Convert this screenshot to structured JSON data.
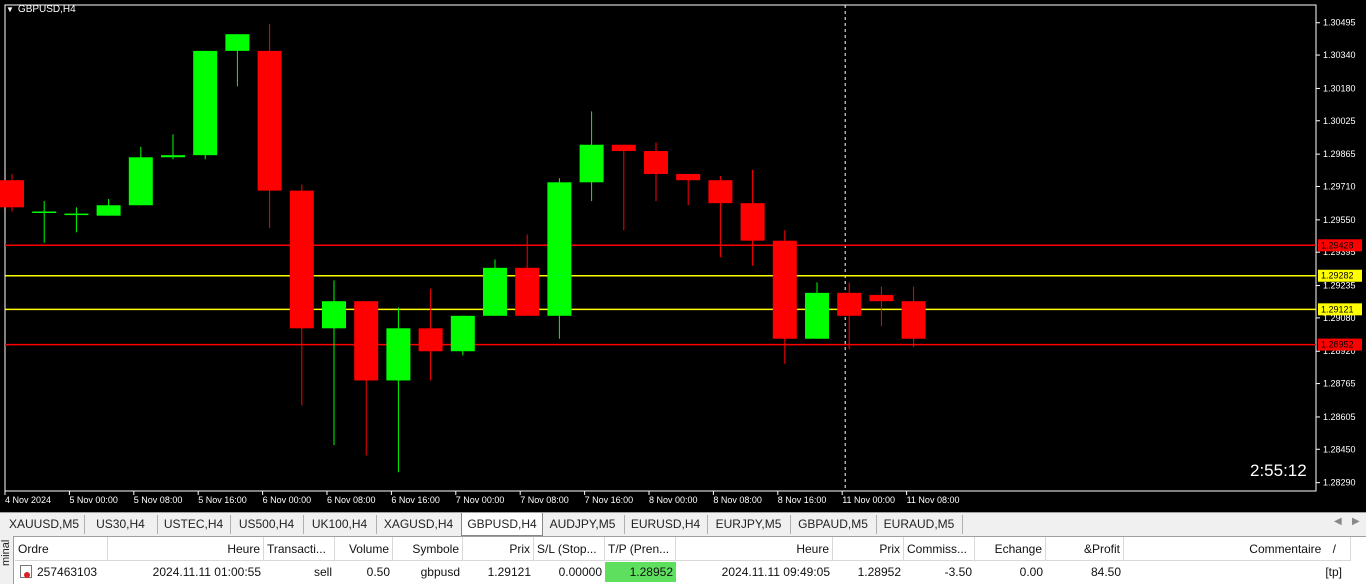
{
  "chart": {
    "symbol_title": "GBPUSD,H4",
    "timer": "2:55:12",
    "price_axis": [
      "1.30495",
      "1.30340",
      "1.30180",
      "1.30025",
      "1.29865",
      "1.29710",
      "1.29550",
      "1.29395",
      "1.29235",
      "1.29080",
      "1.28920",
      "1.28765",
      "1.28605",
      "1.28450",
      "1.28290"
    ],
    "time_axis": [
      "4 Nov 2024",
      "5 Nov 00:00",
      "5 Nov 08:00",
      "5 Nov 16:00",
      "6 Nov 00:00",
      "6 Nov 08:00",
      "6 Nov 16:00",
      "7 Nov 00:00",
      "7 Nov 08:00",
      "7 Nov 16:00",
      "8 Nov 00:00",
      "8 Nov 08:00",
      "8 Nov 16:00",
      "11 Nov 00:00",
      "11 Nov 08:00"
    ],
    "level_labels": {
      "red_top": "1.29428",
      "yellow_top": "1.29282",
      "yellow_bottom": "1.29121",
      "red_bottom": "1.28952"
    },
    "colors": {
      "bull": "#00ff00",
      "bear": "#ff0000",
      "background": "#000000",
      "red_line": "#ff0000",
      "yellow_line": "#ffff00",
      "text": "#ffffff"
    }
  },
  "chart_data": {
    "type": "candlestick",
    "title": "GBPUSD,H4",
    "ylim": [
      1.2825,
      1.3058
    ],
    "levels": [
      1.29428,
      1.29282,
      1.29121,
      1.28952
    ],
    "candles": [
      {
        "o": 1.2974,
        "h": 1.2977,
        "l": 1.2959,
        "c": 1.2961
      },
      {
        "o": 1.2959,
        "h": 1.2964,
        "l": 1.2944,
        "c": 1.2959
      },
      {
        "o": 1.2958,
        "h": 1.2961,
        "l": 1.2949,
        "c": 1.2958
      },
      {
        "o": 1.2957,
        "h": 1.2965,
        "l": 1.2957,
        "c": 1.2962
      },
      {
        "o": 1.2962,
        "h": 1.299,
        "l": 1.2962,
        "c": 1.2985
      },
      {
        "o": 1.2985,
        "h": 1.2996,
        "l": 1.2984,
        "c": 1.2986
      },
      {
        "o": 1.2986,
        "h": 1.3036,
        "l": 1.2984,
        "c": 1.3036
      },
      {
        "o": 1.3036,
        "h": 1.304,
        "l": 1.3019,
        "c": 1.3044
      },
      {
        "o": 1.3036,
        "h": 1.3049,
        "l": 1.2951,
        "c": 1.2969
      },
      {
        "o": 1.2969,
        "h": 1.2972,
        "l": 1.2866,
        "c": 1.2903
      },
      {
        "o": 1.2903,
        "h": 1.2926,
        "l": 1.2847,
        "c": 1.2916
      },
      {
        "o": 1.2916,
        "h": 1.2912,
        "l": 1.2842,
        "c": 1.2878
      },
      {
        "o": 1.2878,
        "h": 1.2913,
        "l": 1.2834,
        "c": 1.2903
      },
      {
        "o": 1.2903,
        "h": 1.2922,
        "l": 1.2878,
        "c": 1.2892
      },
      {
        "o": 1.2892,
        "h": 1.2904,
        "l": 1.289,
        "c": 1.2909
      },
      {
        "o": 1.2909,
        "h": 1.2936,
        "l": 1.2911,
        "c": 1.2932
      },
      {
        "o": 1.2932,
        "h": 1.2948,
        "l": 1.2917,
        "c": 1.2909
      },
      {
        "o": 1.2909,
        "h": 1.2975,
        "l": 1.2898,
        "c": 1.2973
      },
      {
        "o": 1.2973,
        "h": 1.3007,
        "l": 1.2964,
        "c": 1.2991
      },
      {
        "o": 1.2991,
        "h": 1.2987,
        "l": 1.295,
        "c": 1.2988
      },
      {
        "o": 1.2988,
        "h": 1.2992,
        "l": 1.2964,
        "c": 1.2977
      },
      {
        "o": 1.2977,
        "h": 1.2976,
        "l": 1.2962,
        "c": 1.2974
      },
      {
        "o": 1.2974,
        "h": 1.2976,
        "l": 1.2937,
        "c": 1.2963
      },
      {
        "o": 1.2963,
        "h": 1.2979,
        "l": 1.2933,
        "c": 1.2945
      },
      {
        "o": 1.2945,
        "h": 1.295,
        "l": 1.2886,
        "c": 1.2898
      },
      {
        "o": 1.2898,
        "h": 1.2925,
        "l": 1.2898,
        "c": 1.292
      },
      {
        "o": 1.292,
        "h": 1.2925,
        "l": 1.2893,
        "c": 1.2909
      },
      {
        "o": 1.2919,
        "h": 1.2923,
        "l": 1.2904,
        "c": 1.2916
      },
      {
        "o": 1.2916,
        "h": 1.2923,
        "l": 1.2894,
        "c": 1.2898
      }
    ]
  },
  "tabs": [
    "XAUUSD,M5",
    "US30,H4",
    "USTEC,H4",
    "US500,H4",
    "UK100,H4",
    "XAGUSD,H4",
    "GBPUSD,H4",
    "AUDJPY,M5",
    "EURUSD,H4",
    "EURJPY,M5",
    "GBPAUD,M5",
    "EURAUD,M5"
  ],
  "terminal": {
    "side_label": "minal",
    "headers": {
      "ordre": "Ordre",
      "heure": "Heure",
      "transaction": "Transacti...",
      "volume": "Volume",
      "symbole": "Symbole",
      "prix": "Prix",
      "sl": "S/L (Stop...",
      "tp": "T/P (Pren...",
      "heure2": "Heure",
      "prix2": "Prix",
      "commission": "Commiss...",
      "echange": "Echange",
      "profit": "&Profit",
      "commentaire": "Commentaire",
      "sort": "/"
    },
    "row": {
      "ordre": "257463103",
      "heure": "2024.11.11 01:00:55",
      "transaction": "sell",
      "volume": "0.50",
      "symbole": "gbpusd",
      "prix": "1.29121",
      "sl": "0.00000",
      "tp": "1.28952",
      "heure2": "2024.11.11 09:49:05",
      "prix2": "1.28952",
      "commission": "-3.50",
      "echange": "0.00",
      "profit": "84.50",
      "commentaire": "[tp]"
    }
  }
}
